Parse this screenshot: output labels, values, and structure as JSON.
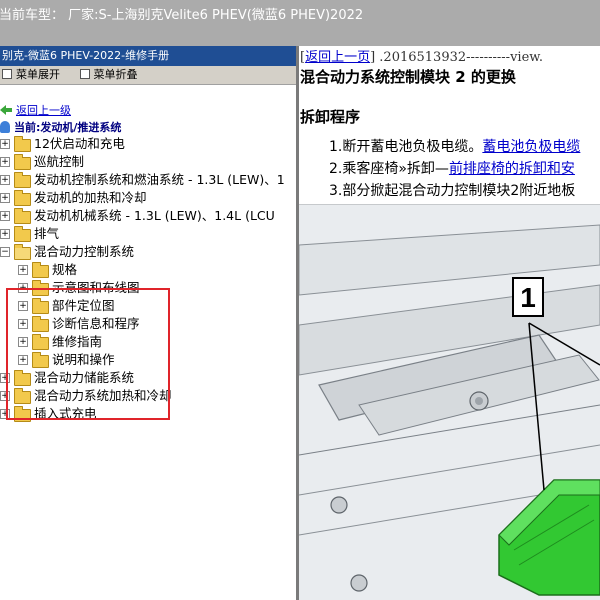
{
  "topbar": {
    "text": "当前车型：  厂家:S-上海别克Velite6 PHEV(微蓝6 PHEV)2022"
  },
  "left_pane": {
    "title": "别克-微蓝6 PHEV-2022-维修手册",
    "tools": {
      "expand": "菜单展开",
      "collapse": "菜单折叠"
    },
    "back_link": "返回上一级",
    "current": "当前:发动机/推进系统",
    "tree": [
      {
        "label": "12伏启动和充电"
      },
      {
        "label": "巡航控制"
      },
      {
        "label": "发动机控制系统和燃油系统 - 1.3L (LEW)、1"
      },
      {
        "label": "发动机的加热和冷却"
      },
      {
        "label": "发动机机械系统 - 1.3L (LEW)、1.4L (LCU"
      },
      {
        "label": "排气"
      },
      {
        "label": "混合动力控制系统"
      },
      {
        "label": "规格"
      },
      {
        "label": "示意图和布线图"
      },
      {
        "label": "部件定位图"
      },
      {
        "label": "诊断信息和程序"
      },
      {
        "label": "维修指南"
      },
      {
        "label": "说明和操作"
      },
      {
        "label": "混合动力储能系统"
      },
      {
        "label": "混合动力系统加热和冷却"
      },
      {
        "label": "插入式充电"
      }
    ]
  },
  "right_pane": {
    "nav": {
      "back_link": "返回上一页",
      "doc_id": "] .2016513932----------view."
    },
    "heading": "混合动力系统控制模块 2 的更换",
    "section": "拆卸程序",
    "steps": {
      "s1_text": "1.断开蓄电池负极电缆。",
      "s1_link": "蓄电池负极电缆",
      "s2_text": "2.乘客座椅»拆卸—",
      "s2_link": "前排座椅的拆卸和安",
      "s3_text": "3.部分掀起混合动力控制模块2附近地板"
    },
    "figure": {
      "callout": "1"
    }
  },
  "colors": {
    "topbar_bg": "#ababab",
    "left_title_bg": "#1f4e94",
    "highlight_border": "#e0242a",
    "link": "#0000cc",
    "module_green": "#32c832"
  }
}
